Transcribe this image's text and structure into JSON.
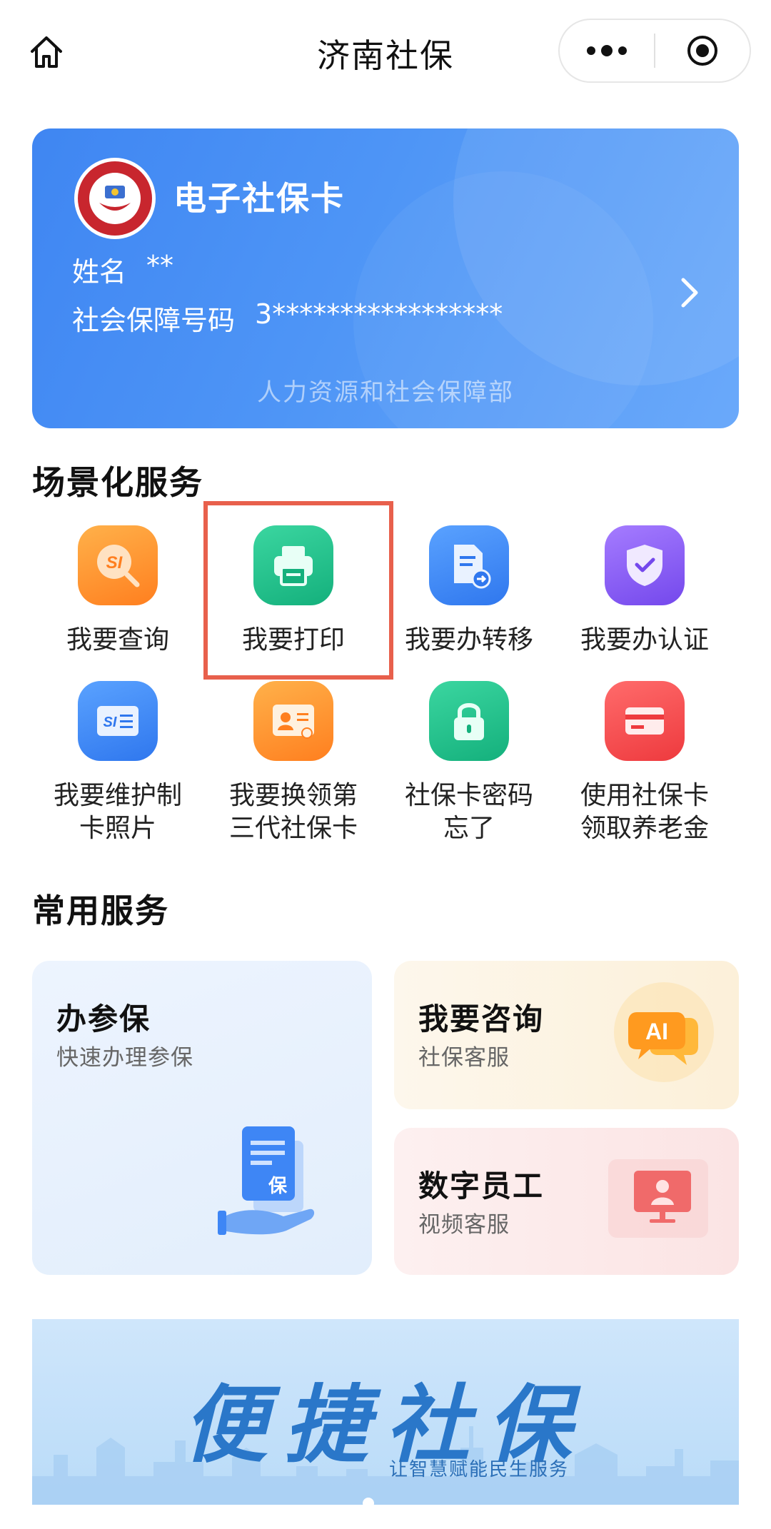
{
  "nav": {
    "title": "济南社保",
    "home_icon": "home-icon",
    "more_icon": "more-dots-icon",
    "close_icon": "target-close-icon"
  },
  "card": {
    "title": "电子社保卡",
    "logo_icon": "social-security-card-logo",
    "name_label": "姓名",
    "name_value": "**",
    "id_label": "社会保障号码",
    "id_value": "3*****************",
    "footer": "人力资源和社会保障部",
    "arrow_icon": "chevron-right-icon"
  },
  "scene_services": {
    "title": "场景化服务",
    "items": [
      {
        "label": "我要查询",
        "icon": "query-icon",
        "color": "#ff8a2a"
      },
      {
        "label": "我要打印",
        "icon": "printer-icon",
        "color": "#21c08b",
        "highlighted": true
      },
      {
        "label": "我要办转移",
        "icon": "document-transfer-icon",
        "color": "#3e86f5"
      },
      {
        "label": "我要办认证",
        "icon": "shield-check-icon",
        "color": "#8a5cf2"
      },
      {
        "label": "我要维护制\n卡照片",
        "icon": "si-card-icon",
        "color": "#3e86f5"
      },
      {
        "label": "我要换领第\n三代社保卡",
        "icon": "id-card-icon",
        "color": "#ff8a2a"
      },
      {
        "label": "社保卡密码\n忘了",
        "icon": "lock-icon",
        "color": "#21c08b"
      },
      {
        "label": "使用社保卡\n领取养老金",
        "icon": "bank-card-icon",
        "color": "#f2454a"
      }
    ]
  },
  "common_services": {
    "title": "常用服务",
    "enroll": {
      "title": "办参保",
      "subtitle": "快速办理参保",
      "icon": "insurance-document-icon",
      "badge_char": "保"
    },
    "consult": {
      "title": "我要咨询",
      "subtitle": "社保客服",
      "icon": "ai-chat-icon",
      "badge_text": "AI"
    },
    "digital": {
      "title": "数字员工",
      "subtitle": "视频客服",
      "icon": "video-service-icon"
    }
  },
  "banner": {
    "title": "便捷社保",
    "subtitle": "让智慧赋能民生服务"
  },
  "colors": {
    "card_blue": "#4e95f6",
    "highlight_red": "#e8604c",
    "banner_blue": "#2a77c9"
  }
}
